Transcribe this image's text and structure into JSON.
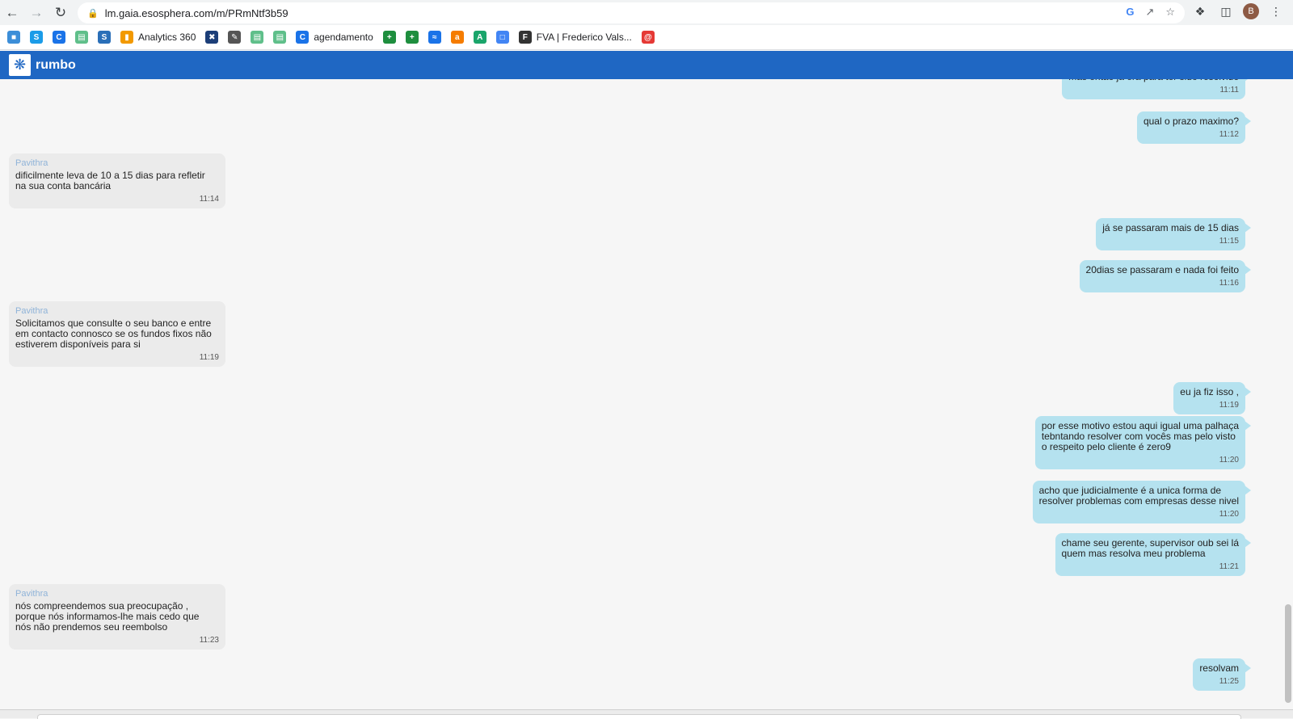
{
  "browser": {
    "url": "lm.gaia.esosphera.com/m/PRmNtf3b59",
    "profile_initial": "B",
    "icons": [
      "back-arrow-icon",
      "forward-arrow-icon",
      "reload-icon",
      "lock-icon",
      "google-icon",
      "share-icon",
      "star-icon",
      "extensions-icon",
      "sidepanel-icon",
      "menu-icon"
    ]
  },
  "bookmarks": [
    {
      "label": "",
      "icon": "folder-icon",
      "color": "#3c8ed8"
    },
    {
      "label": "",
      "icon": "skype-icon",
      "color": "#1b9ce8"
    },
    {
      "label": "",
      "icon": "circle-c-icon",
      "color": "#1a73e8"
    },
    {
      "label": "",
      "icon": "doc-icon",
      "color": "#5fbf8a"
    },
    {
      "label": "",
      "icon": "s-icon",
      "color": "#2a6fb8"
    },
    {
      "label": "Analytics 360",
      "icon": "analytics-icon",
      "color": "#f29900"
    },
    {
      "label": "",
      "icon": "bowtie-icon",
      "color": "#1c3e78"
    },
    {
      "label": "",
      "icon": "pen-icon",
      "color": "#555555"
    },
    {
      "label": "",
      "icon": "doc-icon",
      "color": "#5fbf8a"
    },
    {
      "label": "",
      "icon": "doc-icon",
      "color": "#5fbf8a"
    },
    {
      "label": "agendamento",
      "icon": "circle-c-icon",
      "color": "#1a73e8"
    },
    {
      "label": "",
      "icon": "sheet-icon",
      "color": "#1e8e3e"
    },
    {
      "label": "",
      "icon": "sheet-icon",
      "color": "#1e8e3e"
    },
    {
      "label": "",
      "icon": "wave-icon",
      "color": "#1a73e8"
    },
    {
      "label": "",
      "icon": "a-icon",
      "color": "#f57c00"
    },
    {
      "label": "",
      "icon": "a-circle-icon",
      "color": "#1aa56b"
    },
    {
      "label": "",
      "icon": "calendar-icon",
      "color": "#4285f4"
    },
    {
      "label": "FVA | Frederico Vals...",
      "icon": "fva-icon",
      "color": "#333333"
    },
    {
      "label": "",
      "icon": "target-icon",
      "color": "#e53935"
    }
  ],
  "app": {
    "brand": "rumbo",
    "header_color": "#1f67c3"
  },
  "messages": [
    {
      "dir": "out",
      "sender": "",
      "text": "mas então já era para ter sido resolvido",
      "time": "11:11"
    },
    {
      "dir": "out",
      "sender": "",
      "text": "qual o prazo maximo?",
      "time": "11:12"
    },
    {
      "dir": "in",
      "sender": "Pavithra",
      "text": "dificilmente leva de 10 a 15 dias para refletir\nna sua conta bancária",
      "time": "11:14"
    },
    {
      "dir": "out",
      "sender": "",
      "text": "já se passaram mais de 15 dias",
      "time": "11:15"
    },
    {
      "dir": "out",
      "sender": "",
      "text": "20dias se passaram e nada foi feito",
      "time": "11:16"
    },
    {
      "dir": "in",
      "sender": "Pavithra",
      "text": "Solicitamos que consulte o seu banco e entre\nem contacto connosco se os fundos fixos não\nestiverem disponíveis para si",
      "time": "11:19"
    },
    {
      "dir": "out",
      "sender": "",
      "text": "eu ja fiz isso ,",
      "time": "11:19"
    },
    {
      "dir": "out",
      "sender": "",
      "text": "por esse motivo estou aqui igual uma palhaça\ntebntando resolver com vocês mas pelo visto\no respeito pelo cliente é zero9",
      "time": "11:20"
    },
    {
      "dir": "out",
      "sender": "",
      "text": "acho que judicialmente é a unica forma de\nresolver problemas com empresas desse nivel",
      "time": "11:20"
    },
    {
      "dir": "out",
      "sender": "",
      "text": "chame seu gerente, supervisor oub sei lá\nquem mas resolva meu problema",
      "time": "11:21"
    },
    {
      "dir": "in",
      "sender": "Pavithra",
      "text": "nós compreendemos sua preocupação ,\nporque nós informamos-lhe mais cedo que\nnós não prendemos seu reembolso",
      "time": "11:23"
    },
    {
      "dir": "out",
      "sender": "",
      "text": "resolvam",
      "time": "11:25"
    }
  ]
}
